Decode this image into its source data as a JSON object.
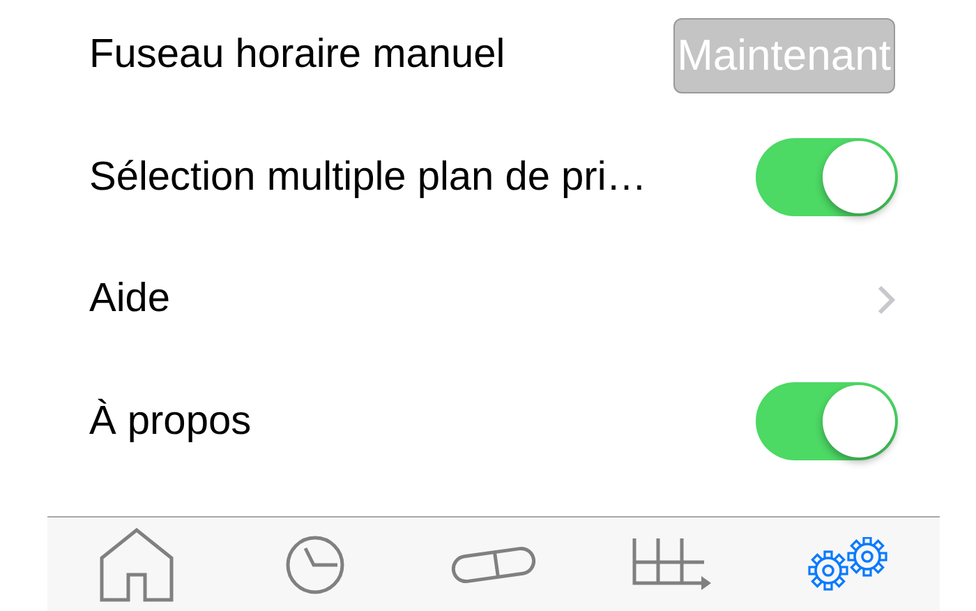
{
  "settings": [
    {
      "kind": "button",
      "label": "Fuseau horaire manuel",
      "button": "Maintenant",
      "disabled": true
    },
    {
      "kind": "toggle",
      "label": "Sélection multiple plan de pri…",
      "on": true
    },
    {
      "kind": "link",
      "label": "Aide"
    },
    {
      "kind": "toggle",
      "label": "À propos",
      "on": true
    }
  ],
  "tabs": [
    {
      "kind": "home",
      "selected": false
    },
    {
      "kind": "clock",
      "selected": false
    },
    {
      "kind": "pill",
      "selected": false
    },
    {
      "kind": "grid",
      "selected": false
    },
    {
      "kind": "gears",
      "selected": true
    }
  ]
}
